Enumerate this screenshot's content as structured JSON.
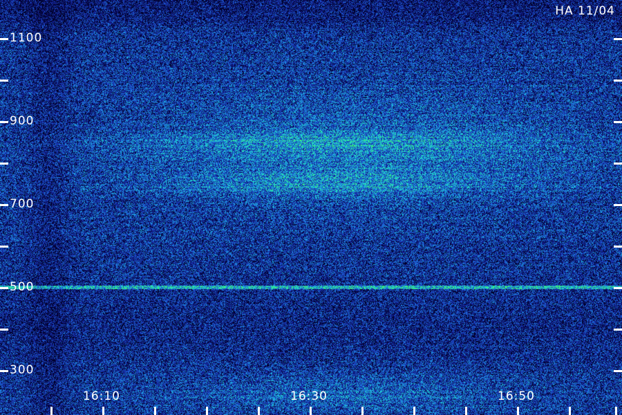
{
  "header": {
    "station_date": "HA 11/04"
  },
  "y_axis": {
    "labels": [
      "1100",
      "900",
      "700",
      "500",
      "300"
    ]
  },
  "x_axis": {
    "labels": [
      "16:10",
      "16:30",
      "16:50"
    ]
  },
  "colors": {
    "background": "#00001a",
    "low": "#1a2a9a",
    "mid": "#1e6fd0",
    "high": "#22e0d0",
    "peak": "#40ff80",
    "annotation": "#ffffff"
  }
}
